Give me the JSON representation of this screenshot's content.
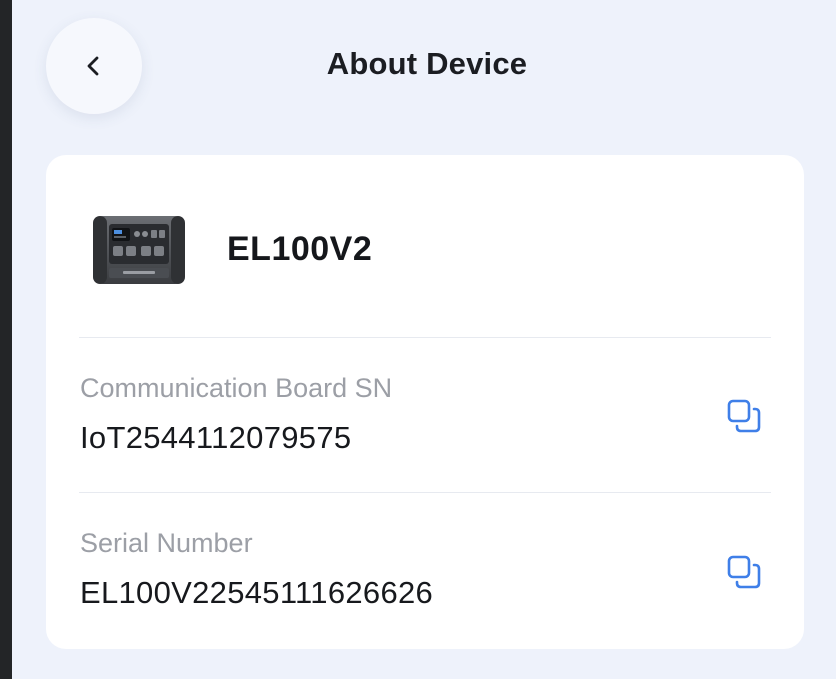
{
  "header": {
    "title": "About Device",
    "back_icon": "chevron-left-icon"
  },
  "device": {
    "name": "EL100V2",
    "image_icon": "power-station-image"
  },
  "info_rows": [
    {
      "label": "Communication Board SN",
      "value": "IoT2544112079575",
      "action_icon": "copy-icon"
    },
    {
      "label": "Serial Number",
      "value": "EL100V22545111626626",
      "action_icon": "copy-icon"
    }
  ],
  "colors": {
    "background": "#eef2fb",
    "card": "#ffffff",
    "accent": "#3f7fe8",
    "label": "#9c9fa6",
    "text": "#17191d"
  }
}
